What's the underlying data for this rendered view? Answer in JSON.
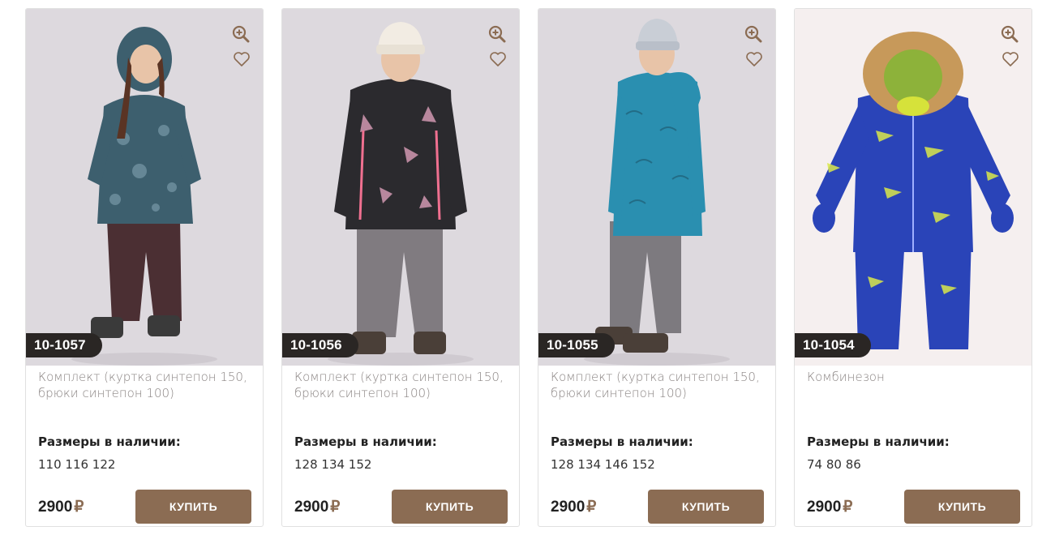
{
  "colors": {
    "accent": "#8b6c53",
    "badge_bg": "#2a2624",
    "name_text": "#8a8483"
  },
  "icons": {
    "zoom": "zoom-in-icon",
    "favorite": "heart-icon",
    "currency": "ruble-icon"
  },
  "products": [
    {
      "article": "10-1057",
      "name": "Комплект (куртка синтепон 150, брюки синтепон 100)",
      "sizes_label": "Размеры в наличии:",
      "sizes": "110 116 122",
      "price": "2900",
      "currency": "₽",
      "buy_label": "КУПИТЬ"
    },
    {
      "article": "10-1056",
      "name": "Комплект (куртка синтепон 150, брюки синтепон 100)",
      "sizes_label": "Размеры в наличии:",
      "sizes": "128 134 152",
      "price": "2900",
      "currency": "₽",
      "buy_label": "КУПИТЬ"
    },
    {
      "article": "10-1055",
      "name": "Комплект (куртка синтепон 150, брюки синтепон 100)",
      "sizes_label": "Размеры в наличии:",
      "sizes": "128 134 146 152",
      "price": "2900",
      "currency": "₽",
      "buy_label": "КУПИТЬ"
    },
    {
      "article": "10-1054",
      "name": "Комбинезон",
      "sizes_label": "Размеры в наличии:",
      "sizes": "74 80 86",
      "price": "2900",
      "currency": "₽",
      "buy_label": "КУПИТЬ"
    }
  ]
}
